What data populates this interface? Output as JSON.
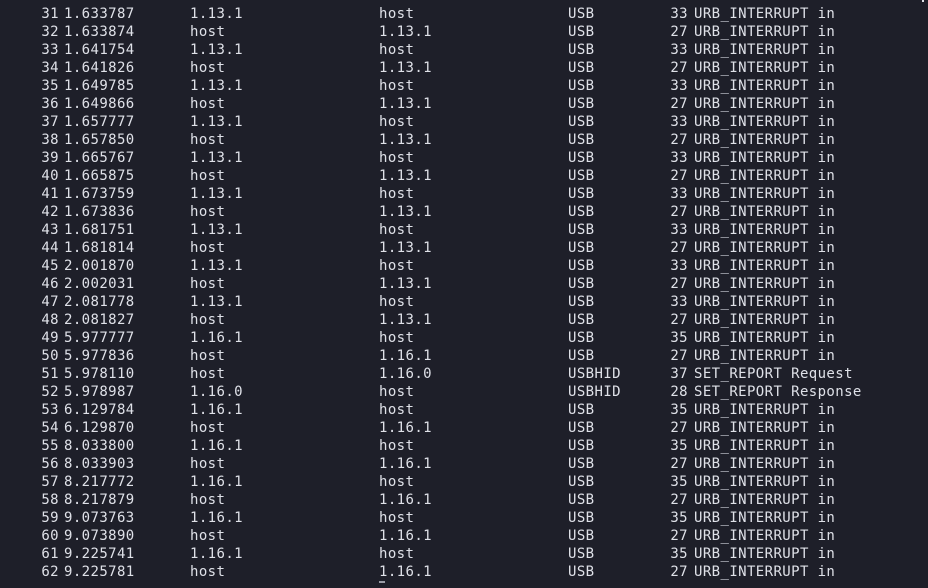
{
  "packets": [
    {
      "no": "31",
      "time": "1.633787",
      "source": "1.13.1",
      "destination": "host",
      "protocol": "USB",
      "length": "33",
      "info": "URB_INTERRUPT in"
    },
    {
      "no": "32",
      "time": "1.633874",
      "source": "host",
      "destination": "1.13.1",
      "protocol": "USB",
      "length": "27",
      "info": "URB_INTERRUPT in"
    },
    {
      "no": "33",
      "time": "1.641754",
      "source": "1.13.1",
      "destination": "host",
      "protocol": "USB",
      "length": "33",
      "info": "URB_INTERRUPT in"
    },
    {
      "no": "34",
      "time": "1.641826",
      "source": "host",
      "destination": "1.13.1",
      "protocol": "USB",
      "length": "27",
      "info": "URB_INTERRUPT in"
    },
    {
      "no": "35",
      "time": "1.649785",
      "source": "1.13.1",
      "destination": "host",
      "protocol": "USB",
      "length": "33",
      "info": "URB_INTERRUPT in"
    },
    {
      "no": "36",
      "time": "1.649866",
      "source": "host",
      "destination": "1.13.1",
      "protocol": "USB",
      "length": "27",
      "info": "URB_INTERRUPT in"
    },
    {
      "no": "37",
      "time": "1.657777",
      "source": "1.13.1",
      "destination": "host",
      "protocol": "USB",
      "length": "33",
      "info": "URB_INTERRUPT in"
    },
    {
      "no": "38",
      "time": "1.657850",
      "source": "host",
      "destination": "1.13.1",
      "protocol": "USB",
      "length": "27",
      "info": "URB_INTERRUPT in"
    },
    {
      "no": "39",
      "time": "1.665767",
      "source": "1.13.1",
      "destination": "host",
      "protocol": "USB",
      "length": "33",
      "info": "URB_INTERRUPT in"
    },
    {
      "no": "40",
      "time": "1.665875",
      "source": "host",
      "destination": "1.13.1",
      "protocol": "USB",
      "length": "27",
      "info": "URB_INTERRUPT in"
    },
    {
      "no": "41",
      "time": "1.673759",
      "source": "1.13.1",
      "destination": "host",
      "protocol": "USB",
      "length": "33",
      "info": "URB_INTERRUPT in"
    },
    {
      "no": "42",
      "time": "1.673836",
      "source": "host",
      "destination": "1.13.1",
      "protocol": "USB",
      "length": "27",
      "info": "URB_INTERRUPT in"
    },
    {
      "no": "43",
      "time": "1.681751",
      "source": "1.13.1",
      "destination": "host",
      "protocol": "USB",
      "length": "33",
      "info": "URB_INTERRUPT in"
    },
    {
      "no": "44",
      "time": "1.681814",
      "source": "host",
      "destination": "1.13.1",
      "protocol": "USB",
      "length": "27",
      "info": "URB_INTERRUPT in"
    },
    {
      "no": "45",
      "time": "2.001870",
      "source": "1.13.1",
      "destination": "host",
      "protocol": "USB",
      "length": "33",
      "info": "URB_INTERRUPT in"
    },
    {
      "no": "46",
      "time": "2.002031",
      "source": "host",
      "destination": "1.13.1",
      "protocol": "USB",
      "length": "27",
      "info": "URB_INTERRUPT in"
    },
    {
      "no": "47",
      "time": "2.081778",
      "source": "1.13.1",
      "destination": "host",
      "protocol": "USB",
      "length": "33",
      "info": "URB_INTERRUPT in"
    },
    {
      "no": "48",
      "time": "2.081827",
      "source": "host",
      "destination": "1.13.1",
      "protocol": "USB",
      "length": "27",
      "info": "URB_INTERRUPT in"
    },
    {
      "no": "49",
      "time": "5.977777",
      "source": "1.16.1",
      "destination": "host",
      "protocol": "USB",
      "length": "35",
      "info": "URB_INTERRUPT in"
    },
    {
      "no": "50",
      "time": "5.977836",
      "source": "host",
      "destination": "1.16.1",
      "protocol": "USB",
      "length": "27",
      "info": "URB_INTERRUPT in"
    },
    {
      "no": "51",
      "time": "5.978110",
      "source": "host",
      "destination": "1.16.0",
      "protocol": "USBHID",
      "length": "37",
      "info": "SET_REPORT Request"
    },
    {
      "no": "52",
      "time": "5.978987",
      "source": "1.16.0",
      "destination": "host",
      "protocol": "USBHID",
      "length": "28",
      "info": "SET_REPORT Response"
    },
    {
      "no": "53",
      "time": "6.129784",
      "source": "1.16.1",
      "destination": "host",
      "protocol": "USB",
      "length": "35",
      "info": "URB_INTERRUPT in"
    },
    {
      "no": "54",
      "time": "6.129870",
      "source": "host",
      "destination": "1.16.1",
      "protocol": "USB",
      "length": "27",
      "info": "URB_INTERRUPT in"
    },
    {
      "no": "55",
      "time": "8.033800",
      "source": "1.16.1",
      "destination": "host",
      "protocol": "USB",
      "length": "35",
      "info": "URB_INTERRUPT in"
    },
    {
      "no": "56",
      "time": "8.033903",
      "source": "host",
      "destination": "1.16.1",
      "protocol": "USB",
      "length": "27",
      "info": "URB_INTERRUPT in"
    },
    {
      "no": "57",
      "time": "8.217772",
      "source": "1.16.1",
      "destination": "host",
      "protocol": "USB",
      "length": "35",
      "info": "URB_INTERRUPT in"
    },
    {
      "no": "58",
      "time": "8.217879",
      "source": "host",
      "destination": "1.16.1",
      "protocol": "USB",
      "length": "27",
      "info": "URB_INTERRUPT in"
    },
    {
      "no": "59",
      "time": "9.073763",
      "source": "1.16.1",
      "destination": "host",
      "protocol": "USB",
      "length": "35",
      "info": "URB_INTERRUPT in"
    },
    {
      "no": "60",
      "time": "9.073890",
      "source": "host",
      "destination": "1.16.1",
      "protocol": "USB",
      "length": "27",
      "info": "URB_INTERRUPT in"
    },
    {
      "no": "61",
      "time": "9.225741",
      "source": "1.16.1",
      "destination": "host",
      "protocol": "USB",
      "length": "35",
      "info": "URB_INTERRUPT in"
    },
    {
      "no": "62",
      "time": "9.225781",
      "source": "host",
      "destination": "1.16.1",
      "protocol": "USB",
      "length": "27",
      "info": "URB_INTERRUPT in"
    }
  ],
  "colors": {
    "background": "#1e1f29",
    "text": "#dfe1e8"
  }
}
